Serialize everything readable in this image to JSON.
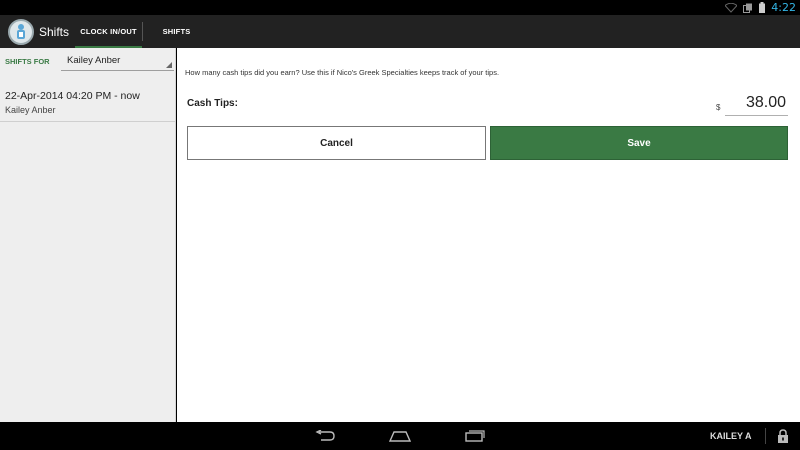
{
  "status_bar": {
    "time": "4:22",
    "icons": [
      "wifi-icon",
      "notification-icon",
      "battery-icon"
    ],
    "time_color": "#33b5e5"
  },
  "action_bar": {
    "app_title": "Shifts",
    "app_icon": "clock-icon",
    "tabs": [
      {
        "label": "CLOCK IN/OUT",
        "selected": true
      },
      {
        "label": "SHIFTS",
        "selected": false
      }
    ]
  },
  "sidebar": {
    "shifts_for_label": "SHIFTS FOR",
    "selected_user": "Kailey Anber",
    "shifts": [
      {
        "time": "22-Apr-2014 04:20 PM - now",
        "name": "Kailey Anber"
      }
    ]
  },
  "main": {
    "prompt": "How many cash tips did you earn? Use this if Nico's Greek Specialties keeps track of your tips.",
    "tips_label": "Cash Tips:",
    "currency_symbol": "$",
    "tips_value": "38.00",
    "cancel_label": "Cancel",
    "save_label": "Save"
  },
  "nav_bar": {
    "user_short": "KAILEY A",
    "icons": [
      "back-icon",
      "home-icon",
      "recent-apps-icon",
      "lock-icon"
    ]
  },
  "colors": {
    "accent_green": "#3a7a44",
    "action_bar_bg": "#222222",
    "sidebar_bg": "#eeeeee"
  }
}
